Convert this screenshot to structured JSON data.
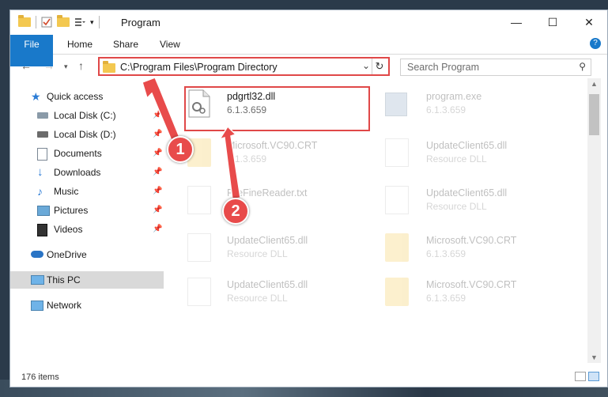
{
  "window": {
    "title": "Program",
    "controls": {
      "minimize": "—",
      "maximize": "☐",
      "close": "✕"
    }
  },
  "ribbon": {
    "tabs": [
      "File",
      "Home",
      "Share",
      "View"
    ],
    "help": "?"
  },
  "address": {
    "path": "C:\\Program Files\\Program Directory",
    "search_placeholder": "Search Program"
  },
  "sidebar": {
    "items": [
      {
        "label": "Quick access",
        "icon": "star-icon",
        "pinned": false
      },
      {
        "label": "Local Disk (C:)",
        "icon": "drive-icon",
        "pinned": true
      },
      {
        "label": "Local Disk (D:)",
        "icon": "drive-icon",
        "pinned": true
      },
      {
        "label": "Documents",
        "icon": "documents-icon",
        "pinned": true
      },
      {
        "label": "Downloads",
        "icon": "download-icon",
        "pinned": true
      },
      {
        "label": "Music",
        "icon": "music-icon",
        "pinned": true
      },
      {
        "label": "Pictures",
        "icon": "pictures-icon",
        "pinned": true
      },
      {
        "label": "Videos",
        "icon": "video-icon",
        "pinned": true
      },
      {
        "label": "OneDrive",
        "icon": "cloud-icon",
        "pinned": false
      },
      {
        "label": "This PC",
        "icon": "computer-icon",
        "pinned": false,
        "selected": true
      },
      {
        "label": "Network",
        "icon": "network-icon",
        "pinned": false
      }
    ]
  },
  "files": [
    {
      "name": "pdgrtl32.dll",
      "detail": "6.1.3.659",
      "type": "dll",
      "highlighted": true
    },
    {
      "name": "program.exe",
      "detail": "6.1.3.659",
      "type": "exe"
    },
    {
      "name": "Microsoft.VC90.CRT",
      "detail": "6.1.3.659",
      "type": "folder"
    },
    {
      "name": "UpdateClient65.dll",
      "detail": "Resource DLL",
      "type": "dll"
    },
    {
      "name": "FileFineReader.txt",
      "detail": "",
      "type": "txt"
    },
    {
      "name": "UpdateClient65.dll",
      "detail": "Resource DLL",
      "type": "dll"
    },
    {
      "name": "UpdateClient65.dll",
      "detail": "Resource DLL",
      "type": "dll"
    },
    {
      "name": "Microsoft.VC90.CRT",
      "detail": "6.1.3.659",
      "type": "folder"
    },
    {
      "name": "UpdateClient65.dll",
      "detail": "Resource DLL",
      "type": "dll"
    },
    {
      "name": "Microsoft.VC90.CRT",
      "detail": "6.1.3.659",
      "type": "folder"
    }
  ],
  "status": {
    "items_count": "176 items"
  },
  "callouts": [
    "1",
    "2"
  ],
  "colors": {
    "accent": "#1979ca",
    "highlight": "#e04848"
  }
}
